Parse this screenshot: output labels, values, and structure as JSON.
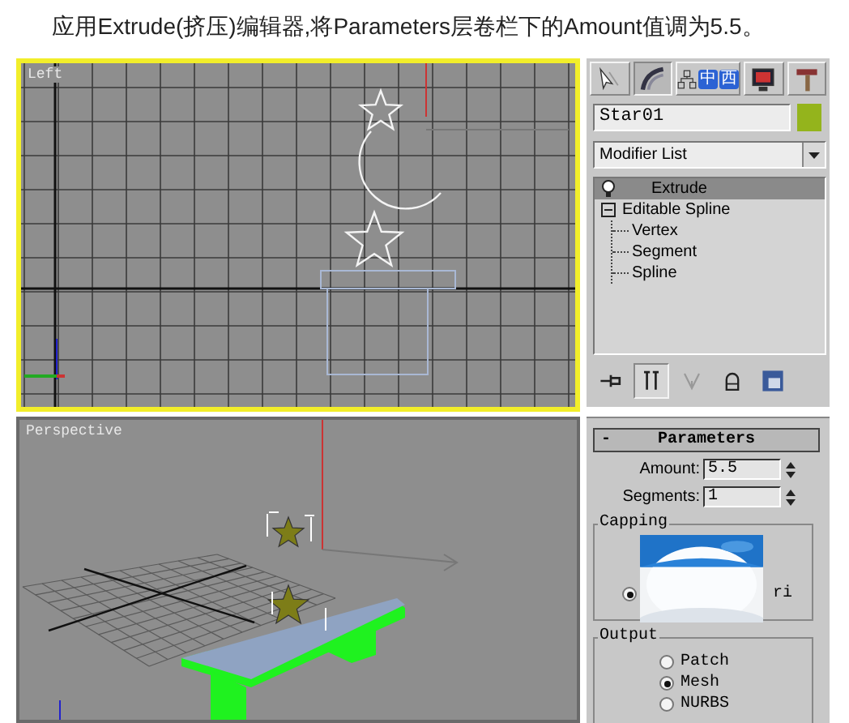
{
  "caption": "应用Extrude(挤压)编辑器,将Parameters层卷栏下的Amount值调为5.5。",
  "viewports": [
    {
      "kind": "left",
      "label": "Left",
      "active": true
    },
    {
      "kind": "perspective",
      "label": "Perspective",
      "active": false
    }
  ],
  "command_panel": {
    "tabs": [
      {
        "kind": "create",
        "selected": false
      },
      {
        "kind": "modify",
        "selected": true
      },
      {
        "kind": "hierarchy",
        "selected": false,
        "badges": [
          "中",
          "西"
        ]
      },
      {
        "kind": "display",
        "selected": false
      },
      {
        "kind": "utilities",
        "selected": false
      }
    ],
    "object_name": "Star01",
    "modifier_list": "Modifier List",
    "stack": [
      {
        "kind": "modifier",
        "label": "Extrude",
        "selected": true
      },
      {
        "kind": "object",
        "label": "Editable Spline",
        "selected": false,
        "expanded": true,
        "children": [
          {
            "label": "Vertex",
            "selected": false
          },
          {
            "label": "Segment",
            "selected": false
          },
          {
            "label": "Spline",
            "selected": false
          }
        ]
      }
    ],
    "stack_tools": [
      {
        "kind": "pin",
        "pressed": false
      },
      {
        "kind": "end-result",
        "pressed": true
      },
      {
        "kind": "unique",
        "pressed": false
      },
      {
        "kind": "remove",
        "pressed": false
      },
      {
        "kind": "configure",
        "pressed": false
      }
    ]
  },
  "parameters": {
    "collapse": "-",
    "title": "Parameters",
    "amount_label": "Amount:",
    "amount": "5.5",
    "segments_label": "Segments:",
    "segments": "1",
    "capping": {
      "title": "Capping",
      "radio_selected": true,
      "partial_label": "ri"
    },
    "output": {
      "title": "Output",
      "options": [
        {
          "label": "Patch",
          "selected": false
        },
        {
          "label": "Mesh",
          "selected": true
        },
        {
          "label": "NURBS",
          "selected": false
        }
      ]
    }
  }
}
